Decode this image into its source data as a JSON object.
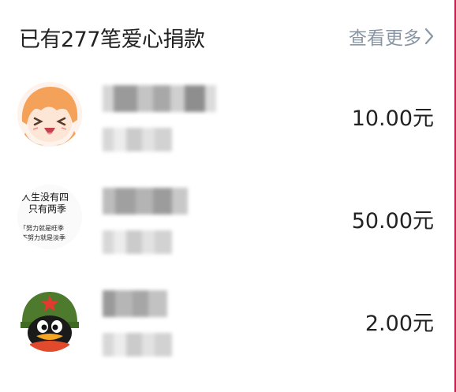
{
  "header": {
    "title": "已有277笔爱心捐款",
    "more_label": "查看更多"
  },
  "donations": [
    {
      "amount": "10.00元",
      "avatar_icon": "anime-girl-avatar-icon"
    },
    {
      "amount": "50.00元",
      "avatar_icon": "calligraphy-text-avatar-icon",
      "avatar_text": [
        "人生没有四",
        "只有两季",
        "「努力就是旺季",
        "不努力就是淡季"
      ]
    },
    {
      "amount": "2.00元",
      "avatar_icon": "qq-penguin-avatar-icon"
    }
  ],
  "colors": {
    "accent": "#c41d4e",
    "title_text": "#222222",
    "more_text": "#8a96a3"
  }
}
